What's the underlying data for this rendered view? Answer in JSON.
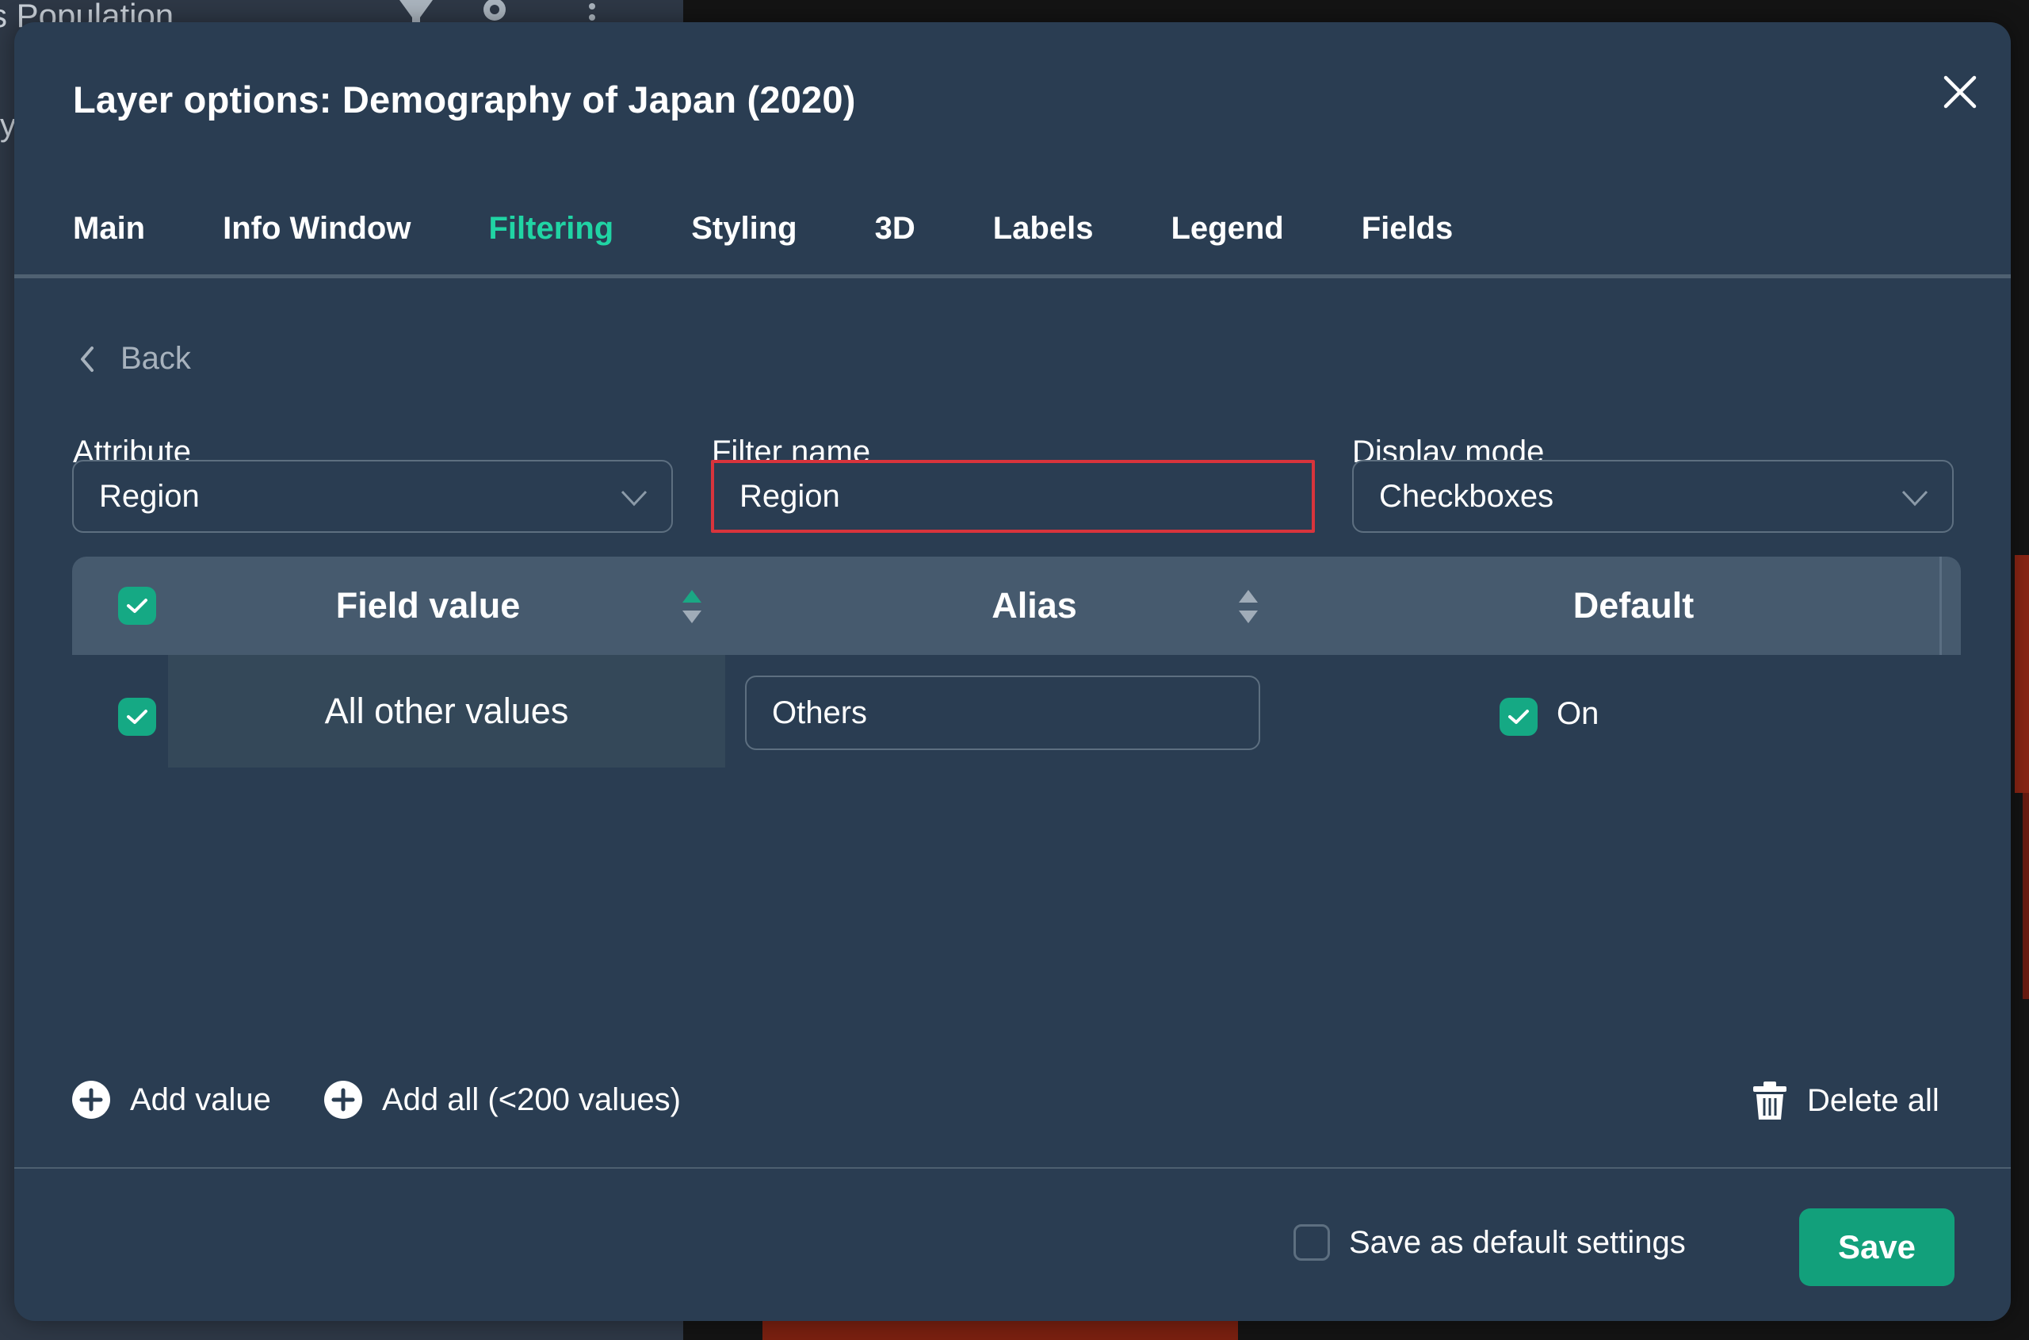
{
  "background": {
    "layer_title": "s Population",
    "letter": "y"
  },
  "modal": {
    "title": "Layer options: Demography of Japan (2020)",
    "tabs": [
      {
        "label": "Main"
      },
      {
        "label": "Info Window"
      },
      {
        "label": "Filtering"
      },
      {
        "label": "Styling"
      },
      {
        "label": "3D"
      },
      {
        "label": "Labels"
      },
      {
        "label": "Legend"
      },
      {
        "label": "Fields"
      }
    ],
    "active_tab": "Filtering",
    "back_label": "Back",
    "attribute": {
      "label": "Attribute",
      "value": "Region"
    },
    "filter_name": {
      "label": "Filter name",
      "value": "Region"
    },
    "display_mode": {
      "label": "Display mode",
      "value": "Checkboxes"
    },
    "table": {
      "columns": [
        "Field value",
        "Alias",
        "Default"
      ],
      "rows": [
        {
          "field_value": "All other values",
          "alias": "Others",
          "default": "On",
          "checked": true
        }
      ]
    },
    "actions": {
      "add_value": "Add value",
      "add_all": "Add all (<200 values)",
      "delete_all": "Delete all"
    },
    "footer": {
      "save_default_label": "Save as default settings",
      "save_label": "Save"
    }
  },
  "colors": {
    "accent": "#20d4a4",
    "checkbox": "#15a984",
    "save_button": "#12a07b",
    "highlight_border": "#d8343c"
  }
}
